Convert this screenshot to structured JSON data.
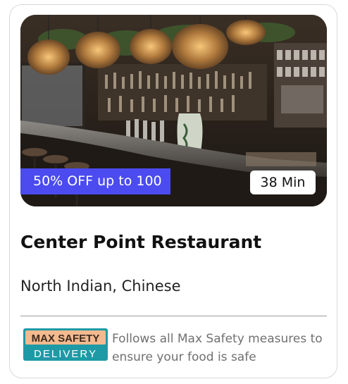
{
  "restaurant": {
    "name": "Center Point Restaurant",
    "cuisines": "North Indian, Chinese",
    "image_description": "restaurant-bar-interior-photo"
  },
  "badges": {
    "offer": "50% OFF up to 100",
    "delivery_time": "38 Min"
  },
  "safety": {
    "logo_line1": "MAX SAFETY",
    "logo_line2": "DELIVERY",
    "message": "Follows all Max Safety measures to ensure your food is safe"
  },
  "colors": {
    "offer_badge": "#4b4bf0",
    "logo_teal": "#1e9aa6",
    "logo_peach": "#f3b98f"
  }
}
